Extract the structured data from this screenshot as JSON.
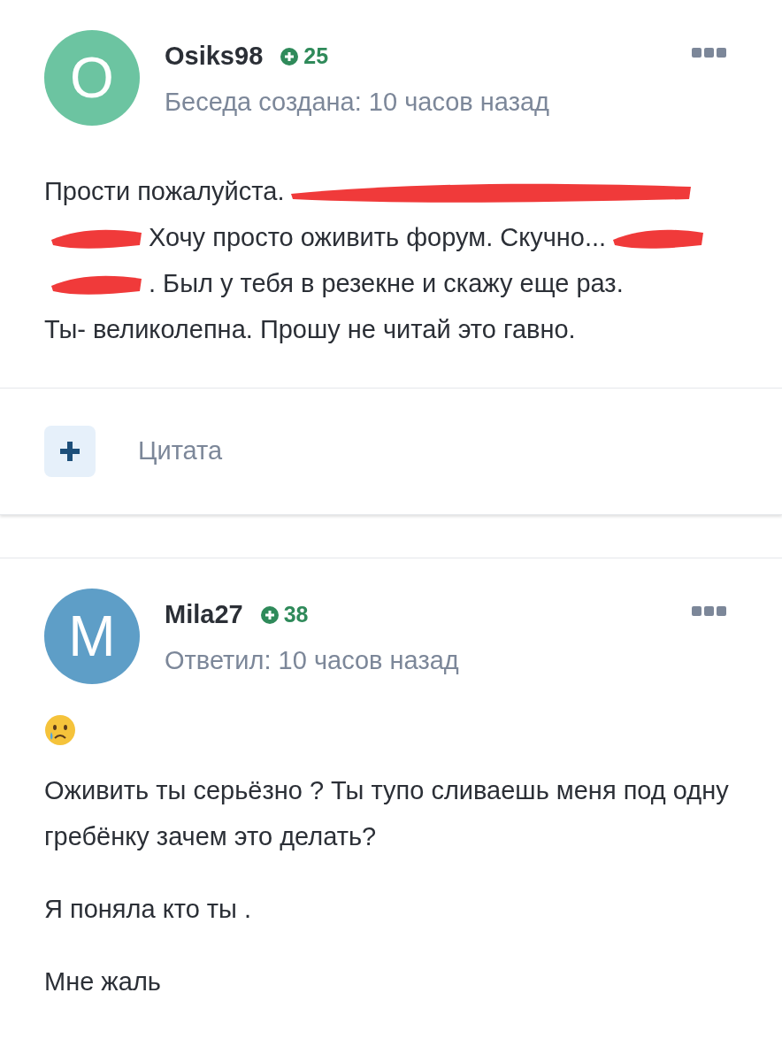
{
  "posts": [
    {
      "avatar": {
        "letter": "O",
        "color": "#6cc4a1"
      },
      "author": "Osiks98",
      "reputation": "25",
      "meta": "Беседа создана: 10 часов назад",
      "body": [
        {
          "kind": "line",
          "segments": [
            {
              "kind": "text",
              "text": "Прости пожалуйста."
            },
            {
              "kind": "redacted-long"
            }
          ]
        },
        {
          "kind": "line",
          "segments": [
            {
              "kind": "redacted-short"
            },
            {
              "kind": "text",
              "text": "Хочу просто оживить форум. Скучно..."
            },
            {
              "kind": "redacted-short"
            }
          ]
        },
        {
          "kind": "line",
          "segments": [
            {
              "kind": "redacted-short"
            },
            {
              "kind": "text",
              "text": ". Был у тебя в резекне и скажу еще раз."
            }
          ]
        },
        {
          "kind": "line",
          "segments": [
            {
              "kind": "text",
              "text": "Ты- великолепна. Прошу не читай это гавно."
            }
          ]
        }
      ],
      "footer": {
        "quote_label": "Цитата"
      }
    },
    {
      "avatar": {
        "letter": "M",
        "color": "#5e9ec7"
      },
      "author": "Mila27",
      "reputation": "38",
      "meta": "Ответил: 10 часов назад",
      "body": [
        {
          "kind": "emoji"
        },
        {
          "kind": "paragraph",
          "text": "Оживить ты серьёзно ? Ты тупо сливаешь меня под одну гребёнку зачем это делать?"
        },
        {
          "kind": "paragraph",
          "text": "Я поняла кто ты ."
        },
        {
          "kind": "paragraph",
          "text": "Мне жаль"
        }
      ]
    }
  ]
}
